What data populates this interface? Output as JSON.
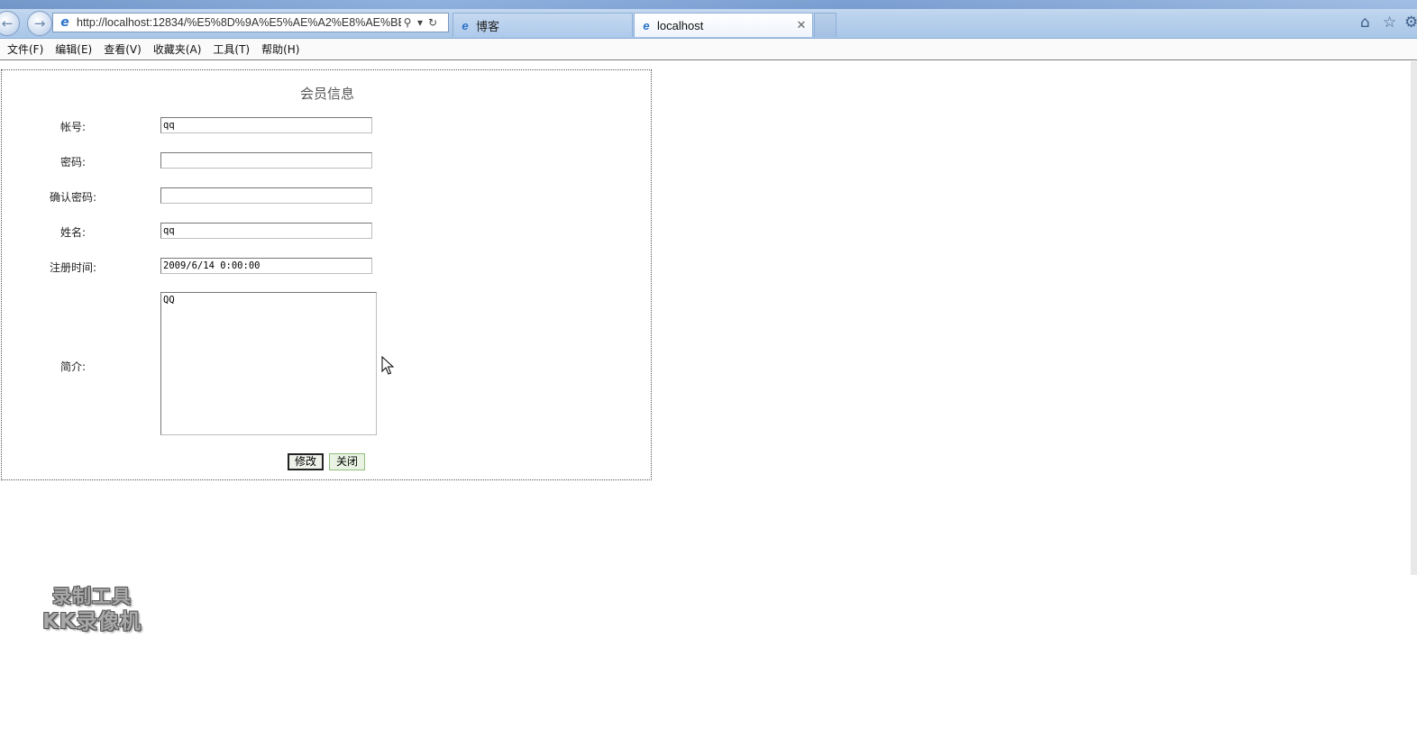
{
  "browser": {
    "address_url": "http://localhost:12834/%E5%8D%9A%E5%AE%A2%E8%AE%BE",
    "tabs": [
      {
        "label": "博客",
        "active": false
      },
      {
        "label": "localhost",
        "active": true
      }
    ],
    "icons": {
      "back": "back-arrow-icon",
      "forward": "forward-arrow-icon",
      "search": "search-icon",
      "refresh": "refresh-icon",
      "home": "home-icon",
      "favorites": "star-icon",
      "tools": "gear-icon"
    }
  },
  "menu": {
    "items": [
      "文件(F)",
      "编辑(E)",
      "查看(V)",
      "收藏夹(A)",
      "工具(T)",
      "帮助(H)"
    ]
  },
  "form": {
    "title": "会员信息",
    "fields": {
      "account": {
        "label": "帐号:",
        "value": "qq"
      },
      "password": {
        "label": "密码:",
        "value": ""
      },
      "confirm_password": {
        "label": "确认密码:",
        "value": ""
      },
      "name": {
        "label": "姓名:",
        "value": "qq"
      },
      "register_time": {
        "label": "注册时间:",
        "value": "2009/6/14 0:00:00"
      },
      "intro": {
        "label": "简介:",
        "value": "QQ"
      }
    },
    "buttons": {
      "modify": "修改",
      "close": "关闭"
    }
  },
  "watermark": {
    "line1": "录制工具",
    "line2": "KK录像机"
  }
}
